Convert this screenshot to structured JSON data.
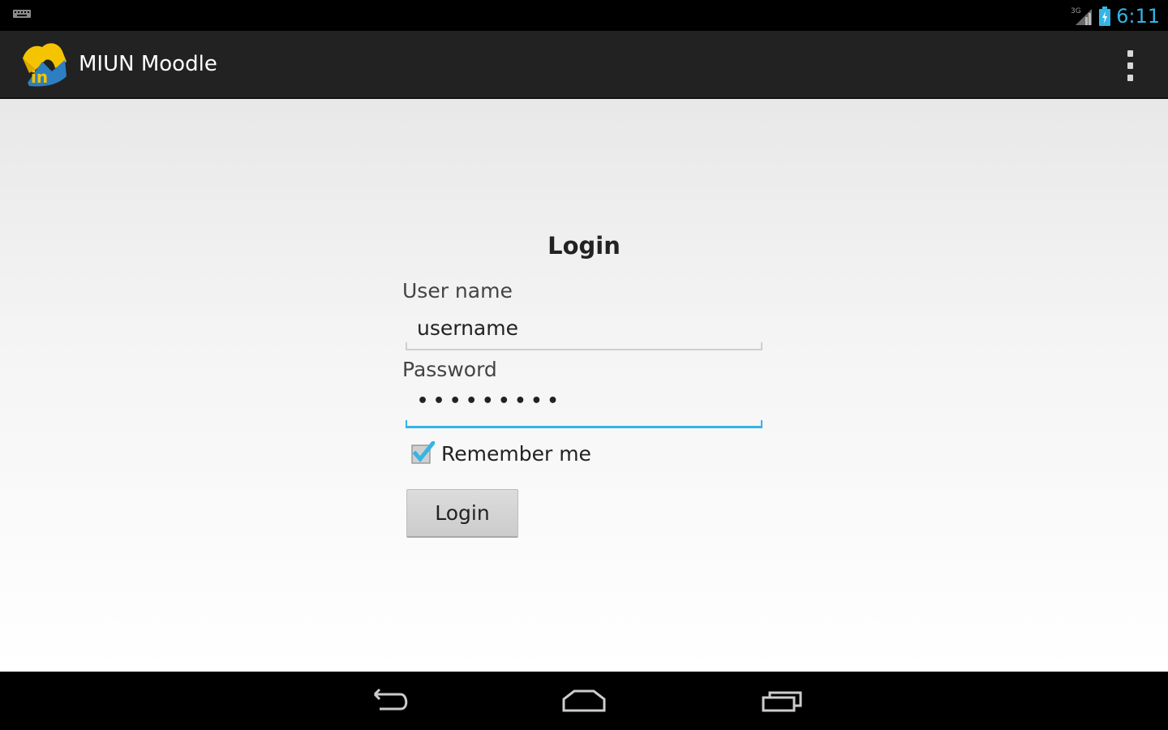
{
  "status_bar": {
    "icons": [
      "keyboard-icon",
      "signal-3g-icon",
      "battery-icon"
    ],
    "network_label": "3G",
    "time": "6:11",
    "accent_color": "#33b5e5"
  },
  "action_bar": {
    "title": "MIUN Moodle",
    "logo_text": "in",
    "logo_icon": "miun-moodle-logo-icon",
    "menu_icon": "overflow-menu-icon"
  },
  "login_form": {
    "title": "Login",
    "username_label": "User name",
    "username_value": "username",
    "password_label": "Password",
    "password_value": "•••••••••",
    "remember_label": "Remember me",
    "remember_checked": true,
    "login_button_label": "Login",
    "focus_color": "#33b5e5"
  },
  "nav_bar": {
    "icons": [
      "back-icon",
      "home-icon",
      "recents-icon"
    ]
  }
}
